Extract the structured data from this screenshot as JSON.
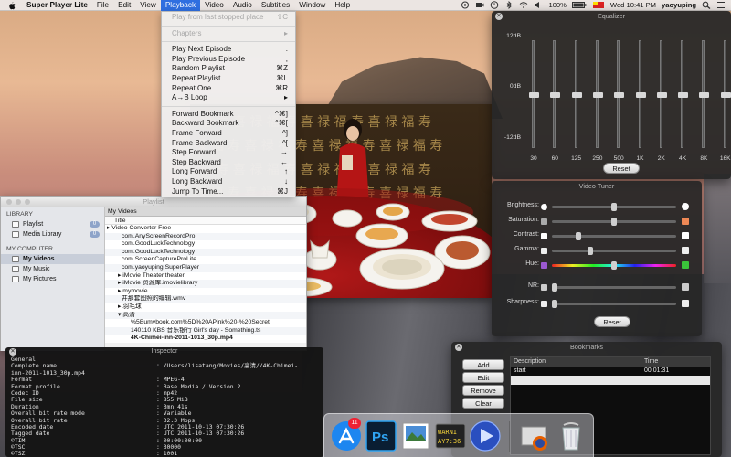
{
  "menubar": {
    "app_name": "Super Player Lite",
    "items": [
      "File",
      "Edit",
      "View",
      "Playback",
      "Video",
      "Audio",
      "Subtitles",
      "Window",
      "Help"
    ],
    "battery": "100%",
    "clock": "Wed 10:41 PM",
    "user": "yaoyuping"
  },
  "playback_menu": {
    "items": [
      {
        "label": "Play from last stopped place",
        "shortcut": "⇧C",
        "disabled": true
      },
      {
        "sep": true
      },
      {
        "label": "Chapters",
        "shortcut": "▸",
        "disabled": true
      },
      {
        "sep": true
      },
      {
        "label": "Play Next Episode",
        "shortcut": "."
      },
      {
        "label": "Play Previous Episode",
        "shortcut": ","
      },
      {
        "label": "Random Playlist",
        "shortcut": "⌘Z"
      },
      {
        "label": "Repeat Playlist",
        "shortcut": "⌘L"
      },
      {
        "label": "Repeat One",
        "shortcut": "⌘R"
      },
      {
        "label": "A→B Loop",
        "shortcut": "▸"
      },
      {
        "sep": true
      },
      {
        "label": "Forward Bookmark",
        "shortcut": "^⌘]"
      },
      {
        "label": "Backward Bookmark",
        "shortcut": "^⌘["
      },
      {
        "label": "Frame Forward",
        "shortcut": "^]"
      },
      {
        "label": "Frame Backward",
        "shortcut": "^["
      },
      {
        "label": "Step Forward",
        "shortcut": "→"
      },
      {
        "label": "Step Backward",
        "shortcut": "←"
      },
      {
        "label": "Long Forward",
        "shortcut": "↑"
      },
      {
        "label": "Long Backward",
        "shortcut": "↓"
      },
      {
        "label": "Jump To Time...",
        "shortcut": "⌘J"
      }
    ]
  },
  "equalizer": {
    "title": "Equalizer",
    "db_labels": [
      "12dB",
      "0dB",
      "-12dB"
    ],
    "bands": [
      {
        "freq": "30",
        "level": 0.0
      },
      {
        "freq": "60",
        "level": 0.0
      },
      {
        "freq": "125",
        "level": 0.0
      },
      {
        "freq": "250",
        "level": 0.0
      },
      {
        "freq": "500",
        "level": 0.0
      },
      {
        "freq": "1K",
        "level": 0.0
      },
      {
        "freq": "2K",
        "level": 0.0
      },
      {
        "freq": "4K",
        "level": 0.0
      },
      {
        "freq": "8K",
        "level": 0.0
      },
      {
        "freq": "16K",
        "level": 0.0
      }
    ],
    "reset_label": "Reset"
  },
  "video_tuner": {
    "title": "Video Tuner",
    "rows": [
      {
        "label": "Brightness:",
        "value": 0.5
      },
      {
        "label": "Saturation:",
        "value": 0.5
      },
      {
        "label": "Contrast:",
        "value": 0.2
      },
      {
        "label": "Gamma:",
        "value": 0.3
      },
      {
        "label": "Hue:",
        "value": 0.5
      },
      {
        "label": "NR:",
        "value": 0.0
      },
      {
        "label": "Sharpness:",
        "value": 0.0
      }
    ],
    "reset_label": "Reset"
  },
  "playlist": {
    "title": "Playlist",
    "library_head": "LIBRARY",
    "library": [
      {
        "label": "Playlist",
        "count": "0"
      },
      {
        "label": "Media Library",
        "count": "0"
      }
    ],
    "computer_head": "MY COMPUTER",
    "computer": [
      {
        "label": "My Videos",
        "selected": true
      },
      {
        "label": "My Music",
        "selected": false
      },
      {
        "label": "My Pictures",
        "selected": false
      }
    ],
    "list_header": "My Videos",
    "column_title": "Title",
    "rows": [
      {
        "text": "▸ Video Converter Free",
        "indent": 2,
        "bold": false
      },
      {
        "text": "com.AnyScreenRecordPro",
        "indent": 18,
        "bold": false
      },
      {
        "text": "com.GoodLuckTechnology",
        "indent": 18,
        "bold": false
      },
      {
        "text": "com.GoodLuckTechnology",
        "indent": 18,
        "bold": false
      },
      {
        "text": "com.ScreenCaptureProLite",
        "indent": 18,
        "bold": false
      },
      {
        "text": "com.yaoyuping.SuperPlayer",
        "indent": 18,
        "bold": false
      },
      {
        "text": "▸ iMovie Theater.theater",
        "indent": 14,
        "bold": false
      },
      {
        "text": "▸ iMovie 资源库.imovielibrary",
        "indent": 14,
        "bold": false
      },
      {
        "text": "▸ mymovie",
        "indent": 14,
        "bold": false
      },
      {
        "text": "井那套图照的编辑.wmv",
        "indent": 18,
        "bold": false
      },
      {
        "text": "▸ 羽毛球",
        "indent": 14,
        "bold": false
      },
      {
        "text": "▾ 高清",
        "indent": 14,
        "bold": false
      },
      {
        "text": "%5Bumvbook.com%5D%20APink%20-%20Secret",
        "indent": 28,
        "bold": false
      },
      {
        "text": "140110 KBS 音乐银行 Girl's day - Something.ts",
        "indent": 28,
        "bold": false
      },
      {
        "text": "4K-Chimei-inn-2011-1013_30p.mp4",
        "indent": 28,
        "bold": true
      }
    ]
  },
  "inspector": {
    "title": "Inspector",
    "rows": [
      {
        "k": "General",
        "v": ""
      },
      {
        "k": "Complete name",
        "v": ": /Users/lisatang/Movies/高清//4K-Chimei-"
      },
      {
        "k": "inn-2011-1013_30p.mp4",
        "v": ""
      },
      {
        "k": "Format",
        "v": ": MPEG-4"
      },
      {
        "k": "Format profile",
        "v": ": Base Media / Version 2"
      },
      {
        "k": "Codec ID",
        "v": ": mp42"
      },
      {
        "k": "File size",
        "v": ": 855 MiB"
      },
      {
        "k": "Duration",
        "v": ": 3mn 41s"
      },
      {
        "k": "Overall bit rate mode",
        "v": ": Variable"
      },
      {
        "k": "Overall bit rate",
        "v": ": 32.3 Mbps"
      },
      {
        "k": "Encoded date",
        "v": ": UTC 2011-10-13 07:30:26"
      },
      {
        "k": "Tagged date",
        "v": ": UTC 2011-10-13 07:30:26"
      },
      {
        "k": "©TIM",
        "v": ": 00:00:00:00"
      },
      {
        "k": "©TSC",
        "v": ": 30000"
      },
      {
        "k": "©TSZ",
        "v": ": 1001"
      }
    ]
  },
  "bookmarks": {
    "title": "Bookmarks",
    "buttons": [
      "Add",
      "Edit",
      "Remove",
      "Clear"
    ],
    "col_desc": "Description",
    "col_time": "Time",
    "rows": [
      {
        "desc": "start",
        "time": "00:01:31"
      }
    ]
  },
  "dock": {
    "badge": "11",
    "icons": [
      "app-store-icon",
      "photoshop-icon",
      "preview-icon",
      "console-icon",
      "super-player-icon",
      "firefox-icon",
      "trash-icon"
    ]
  },
  "colors": {
    "menu_highlight": "#2f6fe0",
    "hud_bg": "#262626",
    "list_select": "#c8ced9"
  }
}
